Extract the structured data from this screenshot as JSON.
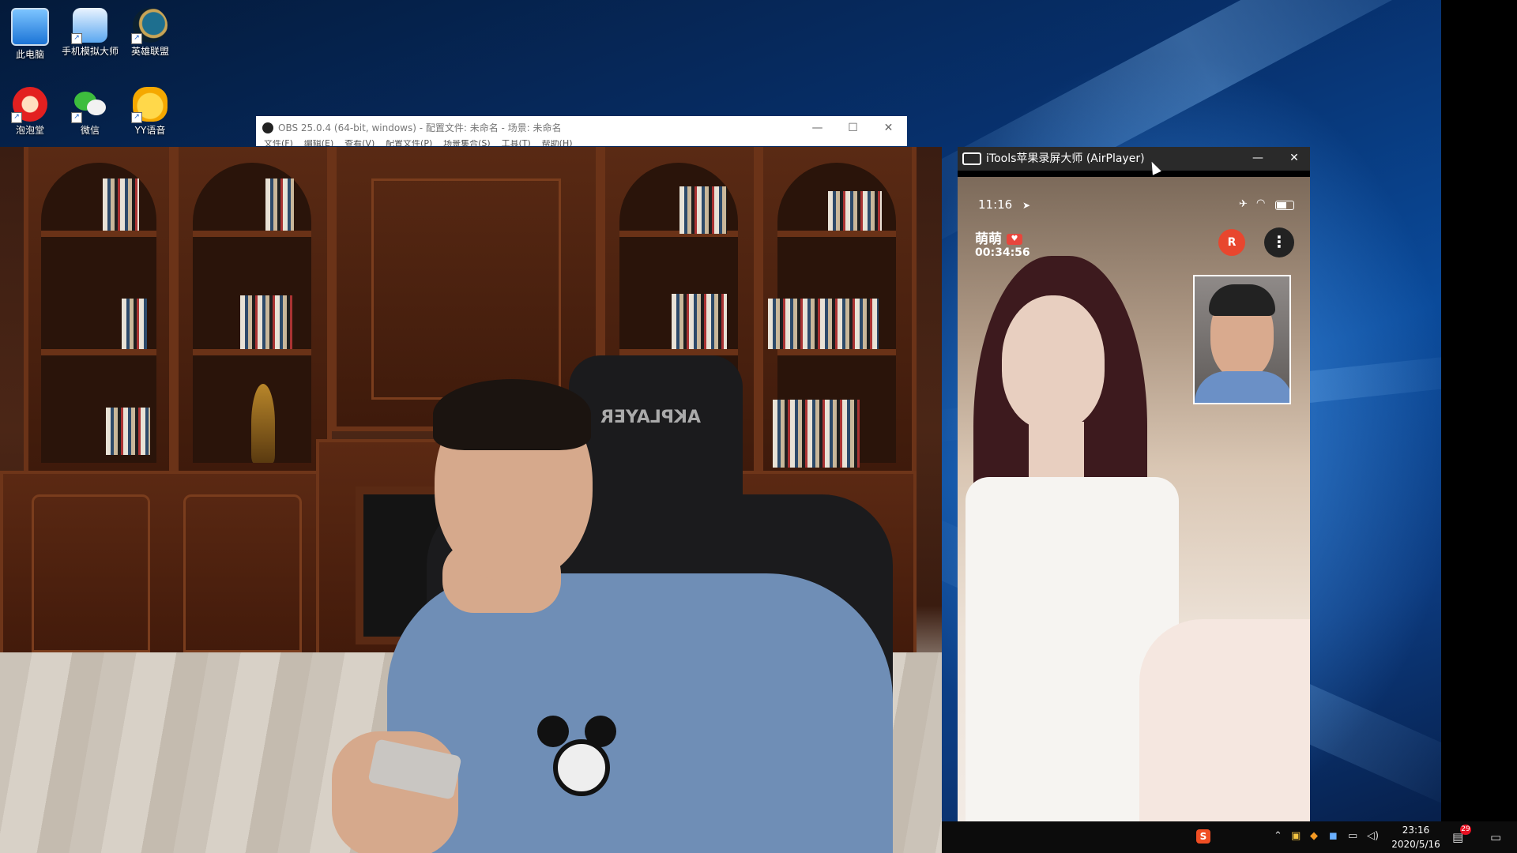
{
  "desktop": {
    "icons": [
      {
        "label": "此电脑",
        "icon": "computer-icon"
      },
      {
        "label": "手机模拟大师",
        "icon": "phone-emulator-icon"
      },
      {
        "label": "英雄联盟",
        "icon": "league-of-legends-icon"
      },
      {
        "label": "泡泡堂",
        "icon": "bnb-game-icon"
      },
      {
        "label": "微信",
        "icon": "wechat-icon"
      },
      {
        "label": "YY语音",
        "icon": "yy-voice-icon"
      }
    ]
  },
  "obs": {
    "title": "OBS 25.0.4 (64-bit, windows) - 配置文件: 未命名 - 场景: 未命名",
    "menu": [
      "文件(F)",
      "编辑(E)",
      "查看(V)",
      "配置文件(P)",
      "场景集合(S)",
      "工具(T)",
      "帮助(H)"
    ],
    "controls": {
      "minimize": "—",
      "maximize": "☐",
      "close": "✕"
    }
  },
  "itools": {
    "title": "iTools苹果录屏大师 (AirPlayer)",
    "controls": {
      "minimize": "—",
      "close": "✕"
    },
    "phone": {
      "time": "11:16",
      "call_name": "萌萌",
      "call_duration": "00:34:56",
      "red_button_label": "R"
    }
  },
  "taskbar": {
    "clock_time": "23:16",
    "clock_date": "2020/5/16",
    "notification_count": "29",
    "colors": {
      "background": "#0c0c0c",
      "badge": "#e81123"
    }
  }
}
